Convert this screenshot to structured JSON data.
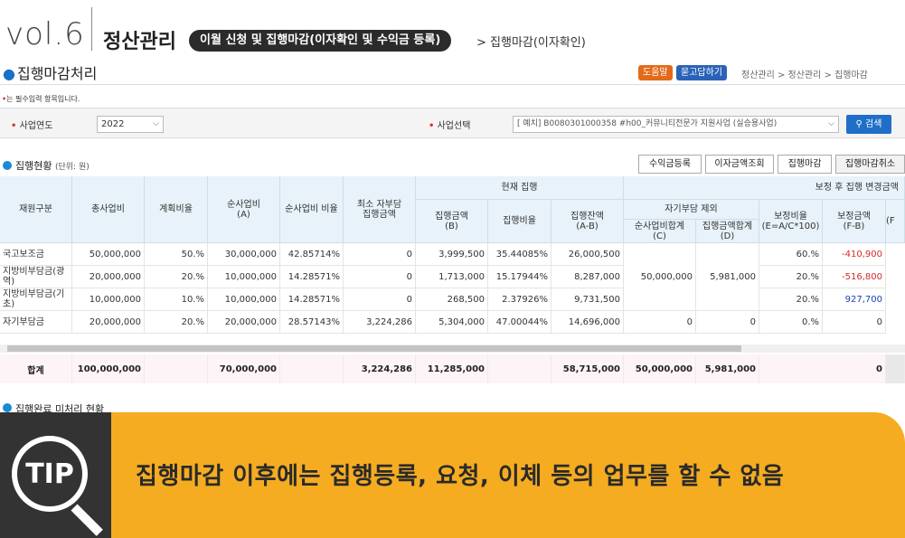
{
  "banner": {
    "vol": "vol.6",
    "section": "정산관리",
    "pill": "이월 신청 및 집행마감(이자확인 및 수익금 등록)",
    "crumb": "> 집행마감(이자확인)"
  },
  "page": {
    "title": "집행마감처리",
    "help": "도움말",
    "ask": "묻고답하기",
    "path": "정산관리 > 정산관리 > 집행마감",
    "required_note": "는 필수입력 항목입니다."
  },
  "search": {
    "year_label": "사업연도",
    "year_value": "2022",
    "biz_label": "사업선택",
    "biz_value": "[ 예치] B0080301000358 #h00_커뮤니티전문가 지원사업 (실승용사업)",
    "search_button": "검색"
  },
  "status": {
    "title": "집행현황",
    "unit": "(단위: 원)",
    "buttons": [
      "수익금등록",
      "이자금액조회",
      "집행마감",
      "집행마감취소"
    ]
  },
  "table": {
    "headers": {
      "fund": "재원구분",
      "total": "총사업비",
      "plan_ratio": "계획비율",
      "net": "순사업비\n(A)",
      "net_ratio": "순사업비 비율",
      "min_self": "최소 자부담\n집행금액",
      "current_group": "현재 집행",
      "exec_amount": "집행금액\n(B)",
      "exec_ratio": "집행비율",
      "exec_balance": "집행잔액\n(A-B)",
      "after_group": "보정 후 집행 변경금액",
      "excl_self": "자기부담 제외",
      "net_sum": "순사업비합계\n(C)",
      "exec_sum": "집행금액합계\n(D)",
      "adj_ratio": "보정비율\n(E=A/C*100)",
      "adj_amount": "보정금액\n(F-B)",
      "extra": "(F"
    },
    "rows": [
      {
        "fund": "국고보조금",
        "total": "50,000,000",
        "plan": "50.%",
        "net": "30,000,000",
        "net_ratio": "42.85714%",
        "min_self": "0",
        "exec": "3,999,500",
        "exec_ratio": "35.44085%",
        "balance": "26,000,500",
        "adj_ratio": "60.%",
        "adj_amount": "-410,900"
      },
      {
        "fund": "지방비부담금(광역)",
        "total": "20,000,000",
        "plan": "20.%",
        "net": "10,000,000",
        "net_ratio": "14.28571%",
        "min_self": "0",
        "exec": "1,713,000",
        "exec_ratio": "15.17944%",
        "balance": "8,287,000",
        "adj_ratio": "20.%",
        "adj_amount": "-516,800"
      },
      {
        "fund": "지방비부담금(기초)",
        "total": "10,000,000",
        "plan": "10.%",
        "net": "10,000,000",
        "net_ratio": "14.28571%",
        "min_self": "0",
        "exec": "268,500",
        "exec_ratio": "2.37926%",
        "balance": "9,731,500",
        "adj_ratio": "20.%",
        "adj_amount": "927,700"
      },
      {
        "fund": "자기부담금",
        "total": "20,000,000",
        "plan": "20.%",
        "net": "20,000,000",
        "net_ratio": "28.57143%",
        "min_self": "3,224,286",
        "exec": "5,304,000",
        "exec_ratio": "47.00044%",
        "balance": "14,696,000",
        "net_sum_self": "0",
        "exec_sum_self": "0",
        "adj_ratio": "0.%",
        "adj_amount": "0"
      }
    ],
    "merged": {
      "net_sum": "50,000,000",
      "exec_sum": "5,981,000"
    },
    "total": {
      "label": "합계",
      "total": "100,000,000",
      "net": "70,000,000",
      "min_self": "3,224,286",
      "exec": "11,285,000",
      "balance": "58,715,000",
      "net_sum": "50,000,000",
      "exec_sum": "5,981,000",
      "adj_amount": "0"
    }
  },
  "next_section": "집행완료 미처리 현황",
  "tip": {
    "badge": "TIP",
    "text": "집행마감 이후에는 집행등록, 요청, 이체 등의 업무를 할 수 없음"
  }
}
